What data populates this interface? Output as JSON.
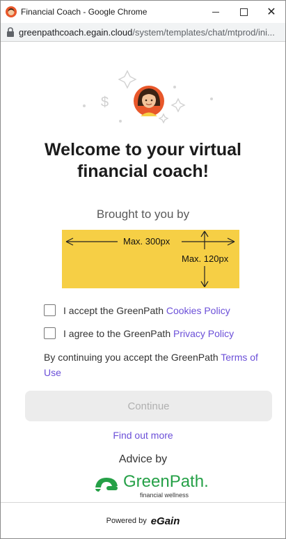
{
  "window": {
    "title": "Financial Coach - Google Chrome",
    "controls": {
      "minimize": "—",
      "maximize": "☐",
      "close": "✕"
    }
  },
  "address": {
    "domain": "greenpathcoach.egain.cloud",
    "path": "/system/templates/chat/mtprod/ini..."
  },
  "main": {
    "headline": "Welcome to your virtual financial coach!",
    "brought_by": "Brought to you by",
    "logo_placeholder": {
      "width_label": "Max. 300px",
      "height_label": "Max. 120px",
      "color": "#f6cf45"
    },
    "cookies": {
      "text": "I accept the GreenPath ",
      "link": "Cookies Policy",
      "checked": false
    },
    "privacy": {
      "text": "I agree to the GreenPath ",
      "link": "Privacy Policy",
      "checked": false
    },
    "terms": {
      "text": "By continuing you accept the GreenPath ",
      "link": "Terms of Use"
    },
    "continue_label": "Continue",
    "find_out_more": "Find out more",
    "advice_by": "Advice by",
    "brand": {
      "name": "GreenPath.",
      "tagline": "financial wellness",
      "color": "#25a047"
    }
  },
  "footer": {
    "powered_by": "Powered by",
    "vendor": "eGain"
  },
  "colors": {
    "link": "#6b4fd8",
    "accent_yellow": "#f6cf45",
    "brand_green": "#25a047"
  },
  "icons": [
    "coach-avatar-icon",
    "lock-icon",
    "sparkle-icon",
    "dollar-icon",
    "greenpath-logo-icon"
  ]
}
